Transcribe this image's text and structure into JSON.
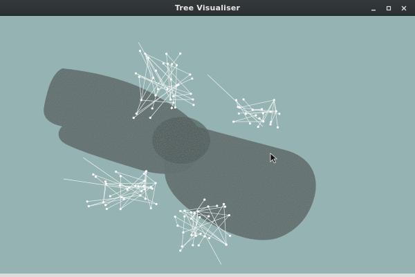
{
  "window": {
    "title": "Tree Visualiser",
    "controls": [
      {
        "name": "minimize-button",
        "icon": "minimize-icon"
      },
      {
        "name": "maximize-button",
        "icon": "maximize-icon"
      },
      {
        "name": "close-button",
        "icon": "close-icon"
      }
    ]
  },
  "colors": {
    "titlebar": "#2f3436",
    "canvas_background": "#95b3b2",
    "point_cloud": "#4f5c5b",
    "tree_lines": "#f2f5f5"
  }
}
